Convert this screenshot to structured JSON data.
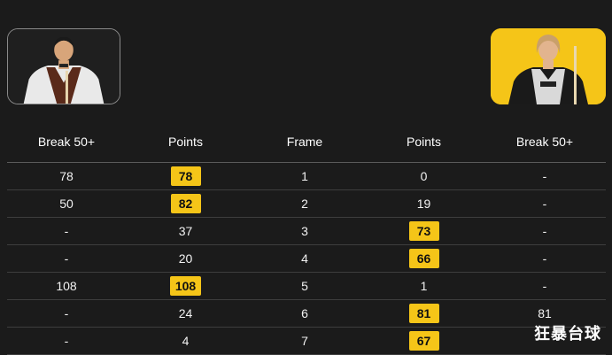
{
  "players": {
    "left": {
      "avatar_icon": "player-photo-icon"
    },
    "right": {
      "avatar_icon": "player-photo-icon"
    }
  },
  "columns": [
    "Break 50+",
    "Points",
    "Frame",
    "Points",
    "Break 50+"
  ],
  "rows": [
    {
      "left_break": "78",
      "left_points": "78",
      "left_win": true,
      "frame": "1",
      "right_points": "0",
      "right_win": false,
      "right_break": "-"
    },
    {
      "left_break": "50",
      "left_points": "82",
      "left_win": true,
      "frame": "2",
      "right_points": "19",
      "right_win": false,
      "right_break": "-"
    },
    {
      "left_break": "-",
      "left_points": "37",
      "left_win": false,
      "frame": "3",
      "right_points": "73",
      "right_win": true,
      "right_break": "-"
    },
    {
      "left_break": "-",
      "left_points": "20",
      "left_win": false,
      "frame": "4",
      "right_points": "66",
      "right_win": true,
      "right_break": "-"
    },
    {
      "left_break": "108",
      "left_points": "108",
      "left_win": true,
      "frame": "5",
      "right_points": "1",
      "right_win": false,
      "right_break": "-"
    },
    {
      "left_break": "-",
      "left_points": "24",
      "left_win": false,
      "frame": "6",
      "right_points": "81",
      "right_win": true,
      "right_break": "81"
    },
    {
      "left_break": "-",
      "left_points": "4",
      "left_win": false,
      "frame": "7",
      "right_points": "67",
      "right_win": true,
      "right_break": ""
    }
  ],
  "watermark": "狂暴台球",
  "colors": {
    "background": "#1b1b1b",
    "accent": "#f5c518",
    "text": "#ffffff",
    "divider": "#3e3e3e"
  }
}
